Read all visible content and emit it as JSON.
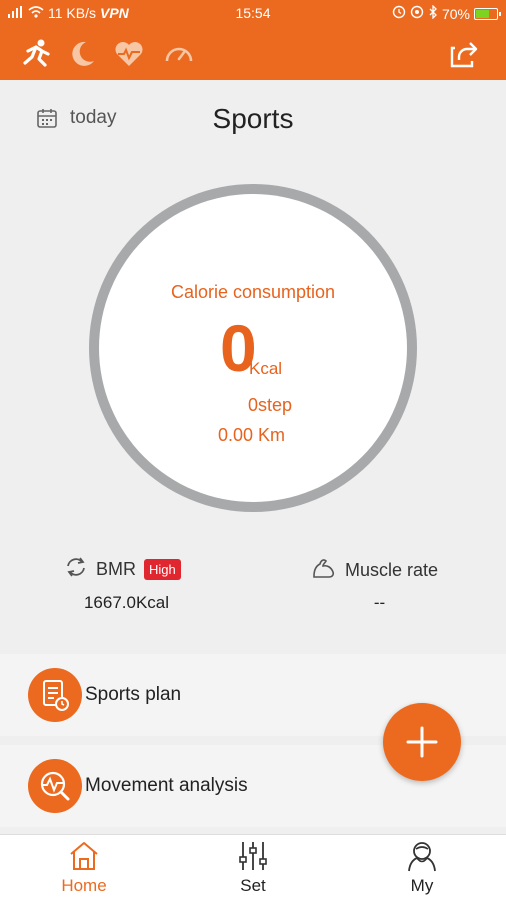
{
  "status_bar": {
    "network": "11 KB/s",
    "vpn": "VPN",
    "time": "15:54",
    "battery": "70%",
    "battery_level": 0.7
  },
  "toolbar": {
    "icons": [
      "running-icon",
      "moon-icon",
      "heart-rate-icon",
      "gauge-icon",
      "share-icon"
    ],
    "accent_color": "#ec6a1f"
  },
  "sports": {
    "date_label": "today",
    "title": "Sports",
    "calorie_title": "Calorie consumption",
    "calorie_value": "0",
    "calorie_unit": "Kcal",
    "steps": "0step",
    "distance": "0.00 Km"
  },
  "metrics": {
    "bmr_label": "BMR",
    "bmr_badge": "High",
    "bmr_value": "1667.0Kcal",
    "muscle_label": "Muscle rate",
    "muscle_value": "--"
  },
  "list": [
    {
      "label": "Sports plan",
      "icon": "plan-icon"
    },
    {
      "label": "Movement analysis",
      "icon": "analysis-icon"
    }
  ],
  "fab": {
    "icon": "plus-icon"
  },
  "nav": [
    {
      "label": "Home",
      "icon": "home-icon",
      "active": true
    },
    {
      "label": "Set",
      "icon": "sliders-icon",
      "active": false
    },
    {
      "label": "My",
      "icon": "user-icon",
      "active": false
    }
  ]
}
